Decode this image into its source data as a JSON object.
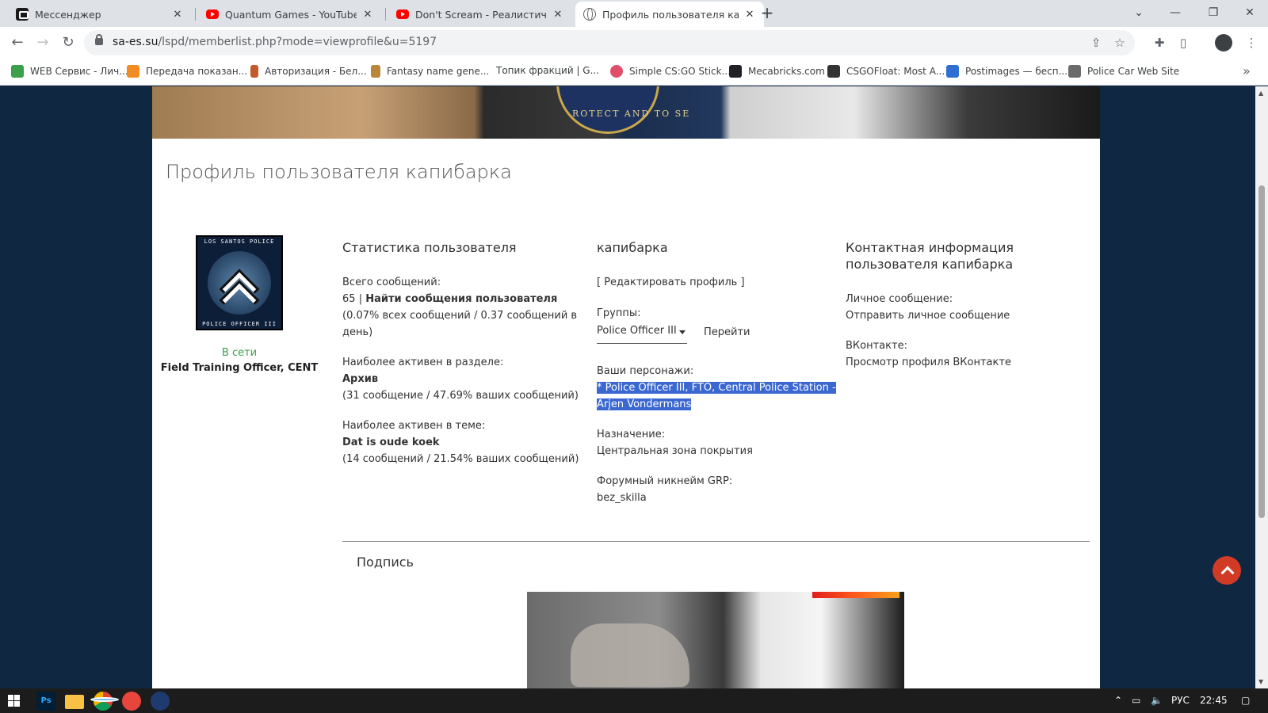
{
  "browser": {
    "tabs": [
      {
        "title": "Мессенджер",
        "icon": "messenger-icon"
      },
      {
        "title": "Quantum Games - YouTube",
        "icon": "youtube-icon"
      },
      {
        "title": "Don't Scream - Реалистичный П",
        "icon": "youtube-icon"
      },
      {
        "title": "Профиль пользователя капиба",
        "icon": "globe-icon"
      }
    ],
    "url_host": "sa-es.su",
    "url_path": "/lspd/memberlist.php?mode=viewprofile&u=5197",
    "bookmarks": [
      "WEB Сервис - Лич...",
      "Передача показан...",
      "Авторизация - Бел...",
      "Fantasy name gene...",
      "Топик фракций | G...",
      "Simple CS:GO Stick...",
      "Mecabricks.com",
      "CSGOFloat: Most A...",
      "Postimages — бесп...",
      "Police Car Web Site"
    ],
    "bookmarks_more": "»"
  },
  "page": {
    "banner_seal_text": "ROTECT AND TO SE",
    "title": "Профиль пользователя капибарка",
    "avatar": {
      "top_text": "LOS SANTOS POLICE",
      "bottom_text": "POLICE OFFICER III"
    },
    "status": "В сети",
    "rank": "Field Training Officer, CENT",
    "stats": {
      "heading": "Статистика пользователя",
      "total_posts_label": "Всего сообщений:",
      "total_posts_value": "65",
      "separator": "|",
      "find_posts": "Найти сообщения пользователя",
      "posts_percent_line1": "(0.07% всех сообщений / 0.37 сообщений в",
      "posts_percent_line2": "день)",
      "active_forum_label": "Наиболее активен в разделе:",
      "active_forum_value": "Архив",
      "active_forum_stats": "(31 сообщение / 47.69% ваших сообщений)",
      "active_topic_label": "Наиболее активен в теме:",
      "active_topic_value": "Dat is oude koek",
      "active_topic_stats": "(14 сообщений / 21.54% ваших сообщений)"
    },
    "profile": {
      "heading": "капибарка",
      "edit_link": "[ Редактировать профиль ]",
      "groups_label": "Группы:",
      "groups_selected": "Police Officer III",
      "go_button": "Перейти",
      "characters_label": "Ваши персонажи:",
      "characters_line1": "* Police Officer III, FTO, Central Police Station -",
      "characters_line2": "Arjen Vondermans",
      "assignment_label": "Назначение:",
      "assignment_value": "Центральная зона покрытия",
      "nickname_label": "Форумный никнейм GRP:",
      "nickname_value": "bez_skilla"
    },
    "contact": {
      "heading_line1": "Контактная информация",
      "heading_line2": "пользователя капибарка",
      "pm_label": "Личное сообщение:",
      "pm_link": "Отправить личное сообщение",
      "vk_label": "ВКонтакте:",
      "vk_link": "Просмотр профиля ВКонтакте"
    },
    "signature_title": "Подпись"
  },
  "taskbar": {
    "lang": "РУС",
    "time": "22:45",
    "ps_label": "Ps"
  },
  "colors": {
    "online": "#3aa04a",
    "selection": "#3a67d0",
    "scroll_top_button": "#d13b26",
    "page_background": "#0f2741"
  }
}
